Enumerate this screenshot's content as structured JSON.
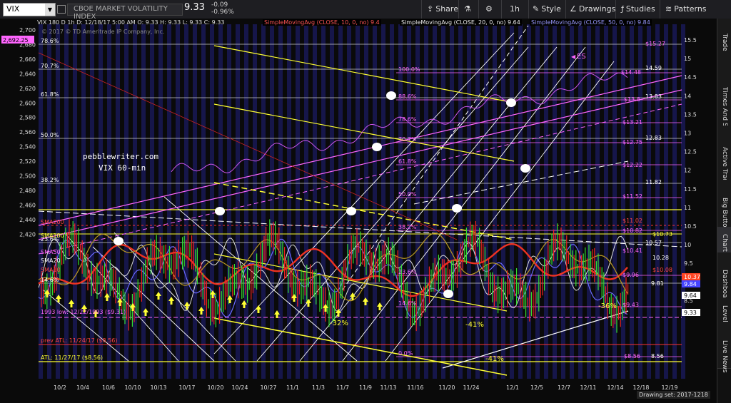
{
  "toolbar": {
    "symbol": "VIX",
    "description": "CBOE MARKET VOLATILITY INDEX",
    "last": "9.33",
    "change": "-0.09",
    "change_pct": "-0.96%",
    "share": "Share",
    "timeframe": "1h",
    "style": "Style",
    "drawings": "Drawings",
    "studies": "Studies",
    "patterns": "Patterns"
  },
  "chart_header": {
    "line1": "VIX 180 D 1h   D: 12/18/17 5:00 AM   O: 9.33   H: 9.33   L: 9.33   C: 9.33",
    "copyright": "© 2017 © TD Ameritrade IP Company, Inc.",
    "sma10": "SimpleMovingAvg (CLOSE, 10, 0, no)  9.4",
    "sma20": "SimpleMovingAvg (CLOSE, 20, 0, no)  9.64",
    "sma50": "SimpleMovingAvg (CLOSE, 50, 0, no)  9.84"
  },
  "watermark": {
    "line1": "pebblewriter.com",
    "line2": "VIX 60-min"
  },
  "left_axis": [
    "2,700",
    "2,680",
    "2,660",
    "2,640",
    "2,620",
    "2,600",
    "2,580",
    "2,560",
    "2,540",
    "2,520",
    "2,500",
    "2,480",
    "2,460",
    "2,440",
    "2,420"
  ],
  "left_axis_highlight": "2,692.25",
  "right_axis": [
    "15.5",
    "15",
    "14.5",
    "14",
    "13.5",
    "13",
    "12.5",
    "12",
    "11.5",
    "11",
    "10.5",
    "10",
    "9.5",
    "9",
    "8.5"
  ],
  "right_tags": {
    "t1": "10.37",
    "t2": "9.84",
    "t3": "9.64",
    "t4": "9.33"
  },
  "x_axis": [
    "10/2",
    "10/4",
    "10/6",
    "10/10",
    "10/13",
    "10/17",
    "10/20",
    "10/24",
    "10/27",
    "11/1",
    "11/3",
    "11/7",
    "11/9",
    "11/13",
    "11/16",
    "11/20",
    "11/24",
    "12/1",
    "12/5",
    "12/7",
    "12/11",
    "12/14",
    "12/18",
    "12/19"
  ],
  "left_fibs": [
    {
      "label": "78.6%"
    },
    {
      "label": "70.7%"
    },
    {
      "label": "61.8%"
    },
    {
      "label": "50.0%"
    },
    {
      "label": "38.2%"
    },
    {
      "label": "23.6%"
    },
    {
      "label": "14.6%"
    }
  ],
  "mid_fibs": [
    {
      "label": "100.0%"
    },
    {
      "label": "88.6%"
    },
    {
      "label": "78.6%"
    },
    {
      "label": "70.7%"
    },
    {
      "label": "61.8%"
    },
    {
      "label": "50.0%"
    },
    {
      "label": "38.2%"
    },
    {
      "label": "23.6%"
    },
    {
      "label": "14.6%"
    },
    {
      "label": "0.0%"
    }
  ],
  "right_levels": [
    {
      "label": "$15.27"
    },
    {
      "label": "$14.48"
    },
    {
      "label": "14.59"
    },
    {
      "label": "$13.8"
    },
    {
      "label": "13.83"
    },
    {
      "label": "$13.21"
    },
    {
      "label": "12.83"
    },
    {
      "label": "$12.75"
    },
    {
      "label": "$12.22"
    },
    {
      "label": "11.82"
    },
    {
      "label": "$11.52"
    },
    {
      "label": "$11.02"
    },
    {
      "label": "$10.82"
    },
    {
      "label": "$10.73"
    },
    {
      "label": "10.57"
    },
    {
      "label": "$10.41"
    },
    {
      "label": "10.28"
    },
    {
      "label": "$10.08"
    },
    {
      "label": "$9.96"
    },
    {
      "label": "9.81"
    },
    {
      "label": "$9.43"
    },
    {
      "label": "$8.56"
    },
    {
      "label": "8.56"
    }
  ],
  "sma_labels": {
    "sma200": "SMA200",
    "sma100": "SMA100",
    "sma50": "SMA50",
    "sma20": "SMA20",
    "sma10": "SMA10"
  },
  "annotations": {
    "low_1993": "1993 low: 12/22/1993 ($9.31)",
    "prev_atl": "prev ATL: 11/24/17 ($8.56)",
    "atl": "ATL: 11/27/17 ($8.56)",
    "pct32": "-32%",
    "pct41a": "-41%",
    "pct41b": "-41%",
    "pct36": "-36%",
    "es": "ES",
    "zero": "0.0%"
  },
  "drawing_set": "Drawing set: 2017-1218",
  "sidebar_tabs": [
    "Trade",
    "Times And Sales",
    "Active Trader",
    "Big Buttons",
    "Chart",
    "Dashboard",
    "Level II",
    "Live News"
  ],
  "colors": {
    "accent_yellow": "#ffff33",
    "magenta": "#ff66ff",
    "red": "#ff2a2a",
    "price_bar_green": "#33dd33",
    "price_bar_red": "#ee2222",
    "blue_sma": "#6a6aff"
  }
}
